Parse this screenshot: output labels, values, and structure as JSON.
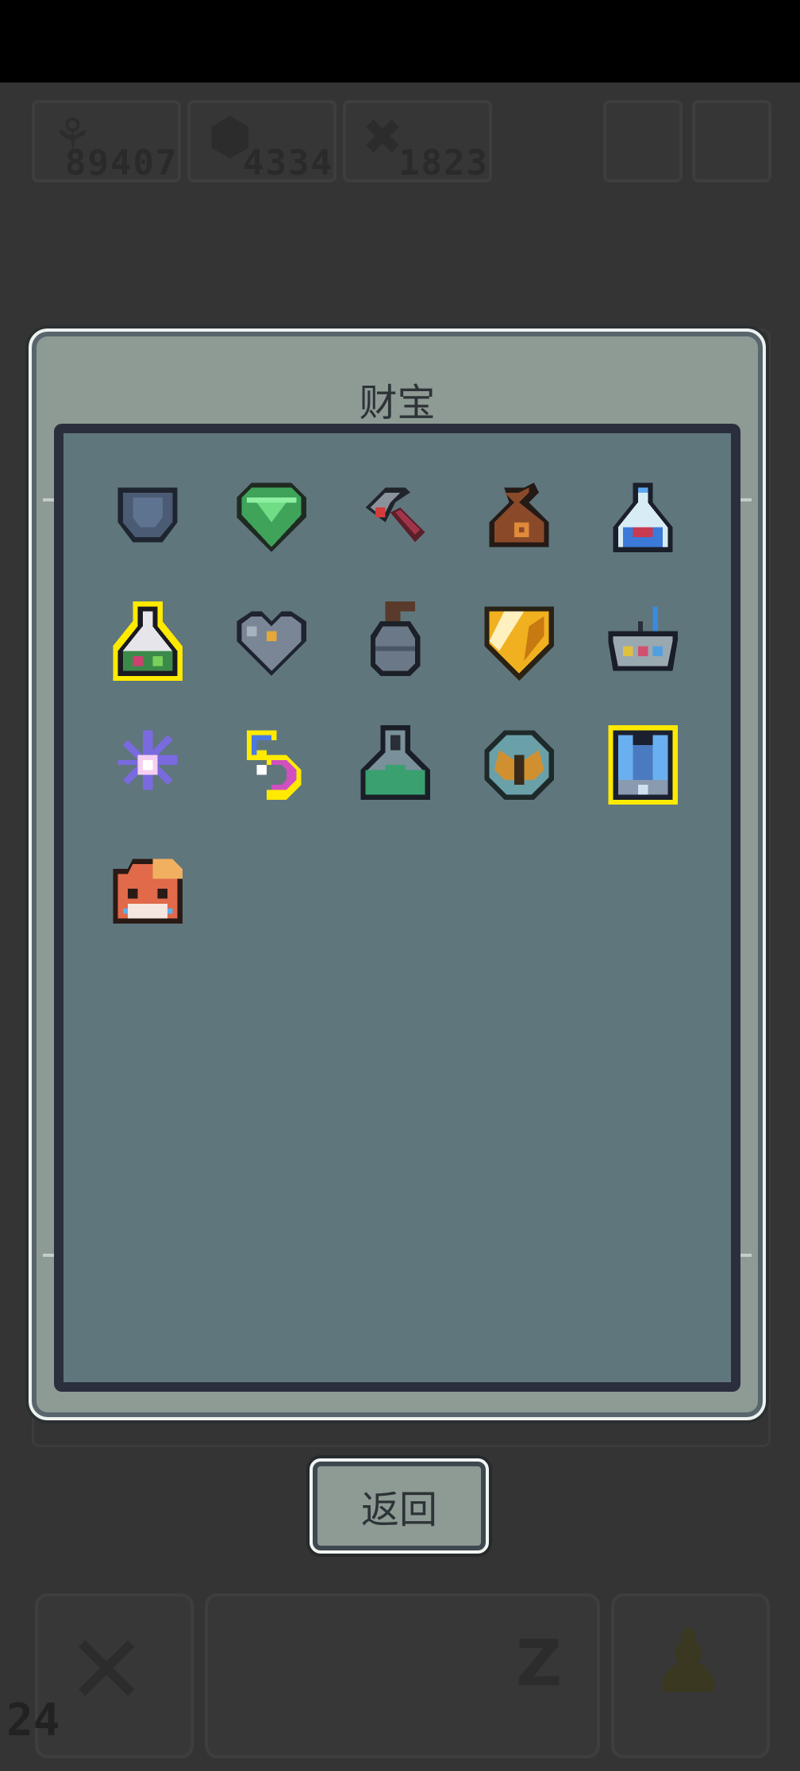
{
  "hud": {
    "currency_1": "89407",
    "currency_2": "4334",
    "currency_3": "1823",
    "currency_1_icon": "seed-icon",
    "currency_2_icon": "gem-icon",
    "currency_3_icon": "material-icon"
  },
  "dialog": {
    "title": "财宝",
    "items": [
      {
        "name": "pocket-icon"
      },
      {
        "name": "green-gem-shield-icon"
      },
      {
        "name": "hammer-icon"
      },
      {
        "name": "money-bag-icon"
      },
      {
        "name": "blue-potion-icon"
      },
      {
        "name": "alchemy-flask-icon",
        "highlight": true
      },
      {
        "name": "metal-heart-icon"
      },
      {
        "name": "grenade-icon"
      },
      {
        "name": "golden-shield-icon"
      },
      {
        "name": "battery-basket-icon"
      },
      {
        "name": "purple-flower-icon"
      },
      {
        "name": "crescent-moon-icon",
        "highlight": true
      },
      {
        "name": "green-flask-icon"
      },
      {
        "name": "butterfly-orb-icon"
      },
      {
        "name": "crystal-armor-icon",
        "highlight": true
      },
      {
        "name": "red-panda-icon"
      }
    ]
  },
  "return_button": {
    "label": "返回"
  },
  "fps": "24",
  "colors": {
    "background": "#343434",
    "dialog_frame": "#8e9a94",
    "grid_panel": "#5f767d",
    "highlight_outline": "#ffea00"
  }
}
